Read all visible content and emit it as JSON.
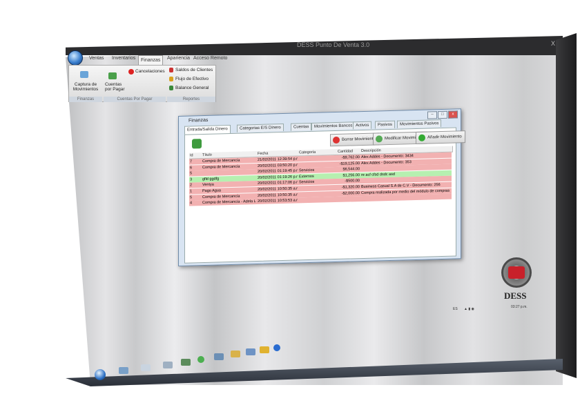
{
  "window": {
    "title": "DESS Punto De Venta 3.0",
    "close": "X"
  },
  "menu": [
    "Ventas",
    "Inventarios",
    "Finanzas",
    "Apariencia",
    "Acceso Remoto"
  ],
  "ribbon": {
    "captura": "Captura de Movimientos",
    "cuentas": "Cuentas por Pagar",
    "cancelaciones": "Cancelaciones",
    "saldos": "Saldos de Clientes",
    "flujo": "Flujo de Efectivo",
    "balance": "Balance General",
    "groups": [
      "Finanzas",
      "Cuentas Por Pagar",
      "Reportes"
    ]
  },
  "dialog": {
    "title": "Finanzas",
    "tabs": [
      "Entrada/Salida Dinero",
      "Categorias E/S Dinero",
      "Cuentas",
      "Movimientos Bancos",
      "Activos",
      "Pasivos",
      "Movimientos Pasivos"
    ],
    "actions": {
      "borrar": "Borrar Movimiento",
      "modificar": "Modificar Movimiento",
      "anadir": "Añadir Movimiento"
    },
    "columns": [
      "Id",
      "Título",
      "Fecha",
      "Categoría",
      "Cantidad",
      "Descripción"
    ],
    "rows": [
      {
        "id": "7",
        "titulo": "Compra de Mercancía",
        "fecha": "21/02/2011 12:39:54 p.r",
        "categoria": "",
        "cantidad": "-$9,762.00",
        "descripcion": "Alex Addes - Documento: 3434",
        "color": "#f2b1b1"
      },
      {
        "id": "6",
        "titulo": "Compra de Mercancía",
        "fecha": "20/02/2011 03:50:20 p.r",
        "categoria": "",
        "cantidad": "-$19,125.00",
        "descripcion": "Alex Addes - Documento: 353",
        "color": "#f2b1b1"
      },
      {
        "id": "5",
        "titulo": "",
        "fecha": "20/02/2011 01:19:45 p.r",
        "categoria": "Servicios",
        "cantidad": "$6,544.00",
        "descripcion": "",
        "color": "#f2b1b1"
      },
      {
        "id": "3",
        "titulo": "gfld ggdfg",
        "fecha": "20/02/2011 01:19:26 p.r",
        "categoria": "Externos",
        "cantidad": "$1,256.00",
        "descripcion": "re acf cfsd dsdc asd",
        "color": "#b6f0b0"
      },
      {
        "id": "2",
        "titulo": "Ventya",
        "fecha": "20/02/2011 01:17:06 p.r",
        "categoria": "Servicios",
        "cantidad": "-$500.00",
        "descripcion": "",
        "color": "#f2b1b1"
      },
      {
        "id": "1",
        "titulo": "Pago Agua",
        "fecha": "20/02/2011 10:50:35 a.r",
        "categoria": "",
        "cantidad": "-$1,320.00",
        "descripcion": "Business Casual S.A de C.V - Documento: 256",
        "color": "#f2b1b1"
      },
      {
        "id": "5",
        "titulo": "Compra de Mercancía",
        "fecha": "20/02/2011 10:50:35 a.r",
        "categoria": "",
        "cantidad": "-$2,000.00",
        "descripcion": "Compra realizada por medio del módulo de compras",
        "color": "#f2b1b1"
      },
      {
        "id": "4",
        "titulo": "Compra de Mercancía - Adela La",
        "fecha": "20/02/2011 10:53:53 a.r",
        "categoria": "",
        "cantidad": "",
        "descripcion": "",
        "color": "#f2b1b1"
      }
    ]
  },
  "logo": "DESS",
  "tray": {
    "lang": "ES",
    "time": "03:27 p.m.",
    "date": ""
  },
  "colors": {
    "red_row": "#f2b1b1",
    "green_row": "#b6f0b0",
    "titlebar": "#2c2c2e"
  }
}
